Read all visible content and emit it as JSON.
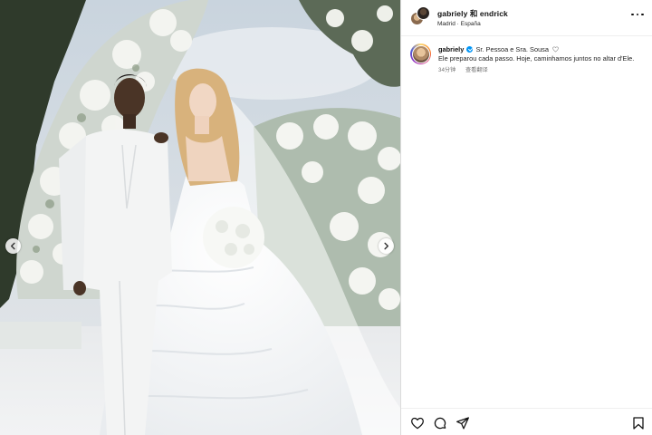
{
  "post": {
    "media": {
      "carousel": {
        "prev_icon": "chevron-left-icon",
        "next_icon": "chevron-right-icon"
      }
    },
    "header": {
      "usernames": "gabriely 和 endrick",
      "location": "Madrid · España",
      "more_icon": "more-horizontal-icon"
    },
    "caption": {
      "username": "gabriely",
      "verified": true,
      "text_line1": "Sr. Pessoa e Sra. Sousa",
      "text_rest": "Ele preparou cada passo. Hoje, caminhamos juntos no altar d'Ele.",
      "timestamp": "34分钟",
      "translation_link": "查看翻译"
    },
    "actions": {
      "like_icon": "heart-icon",
      "comment_icon": "comment-icon",
      "share_icon": "send-icon",
      "save_icon": "bookmark-icon"
    }
  }
}
